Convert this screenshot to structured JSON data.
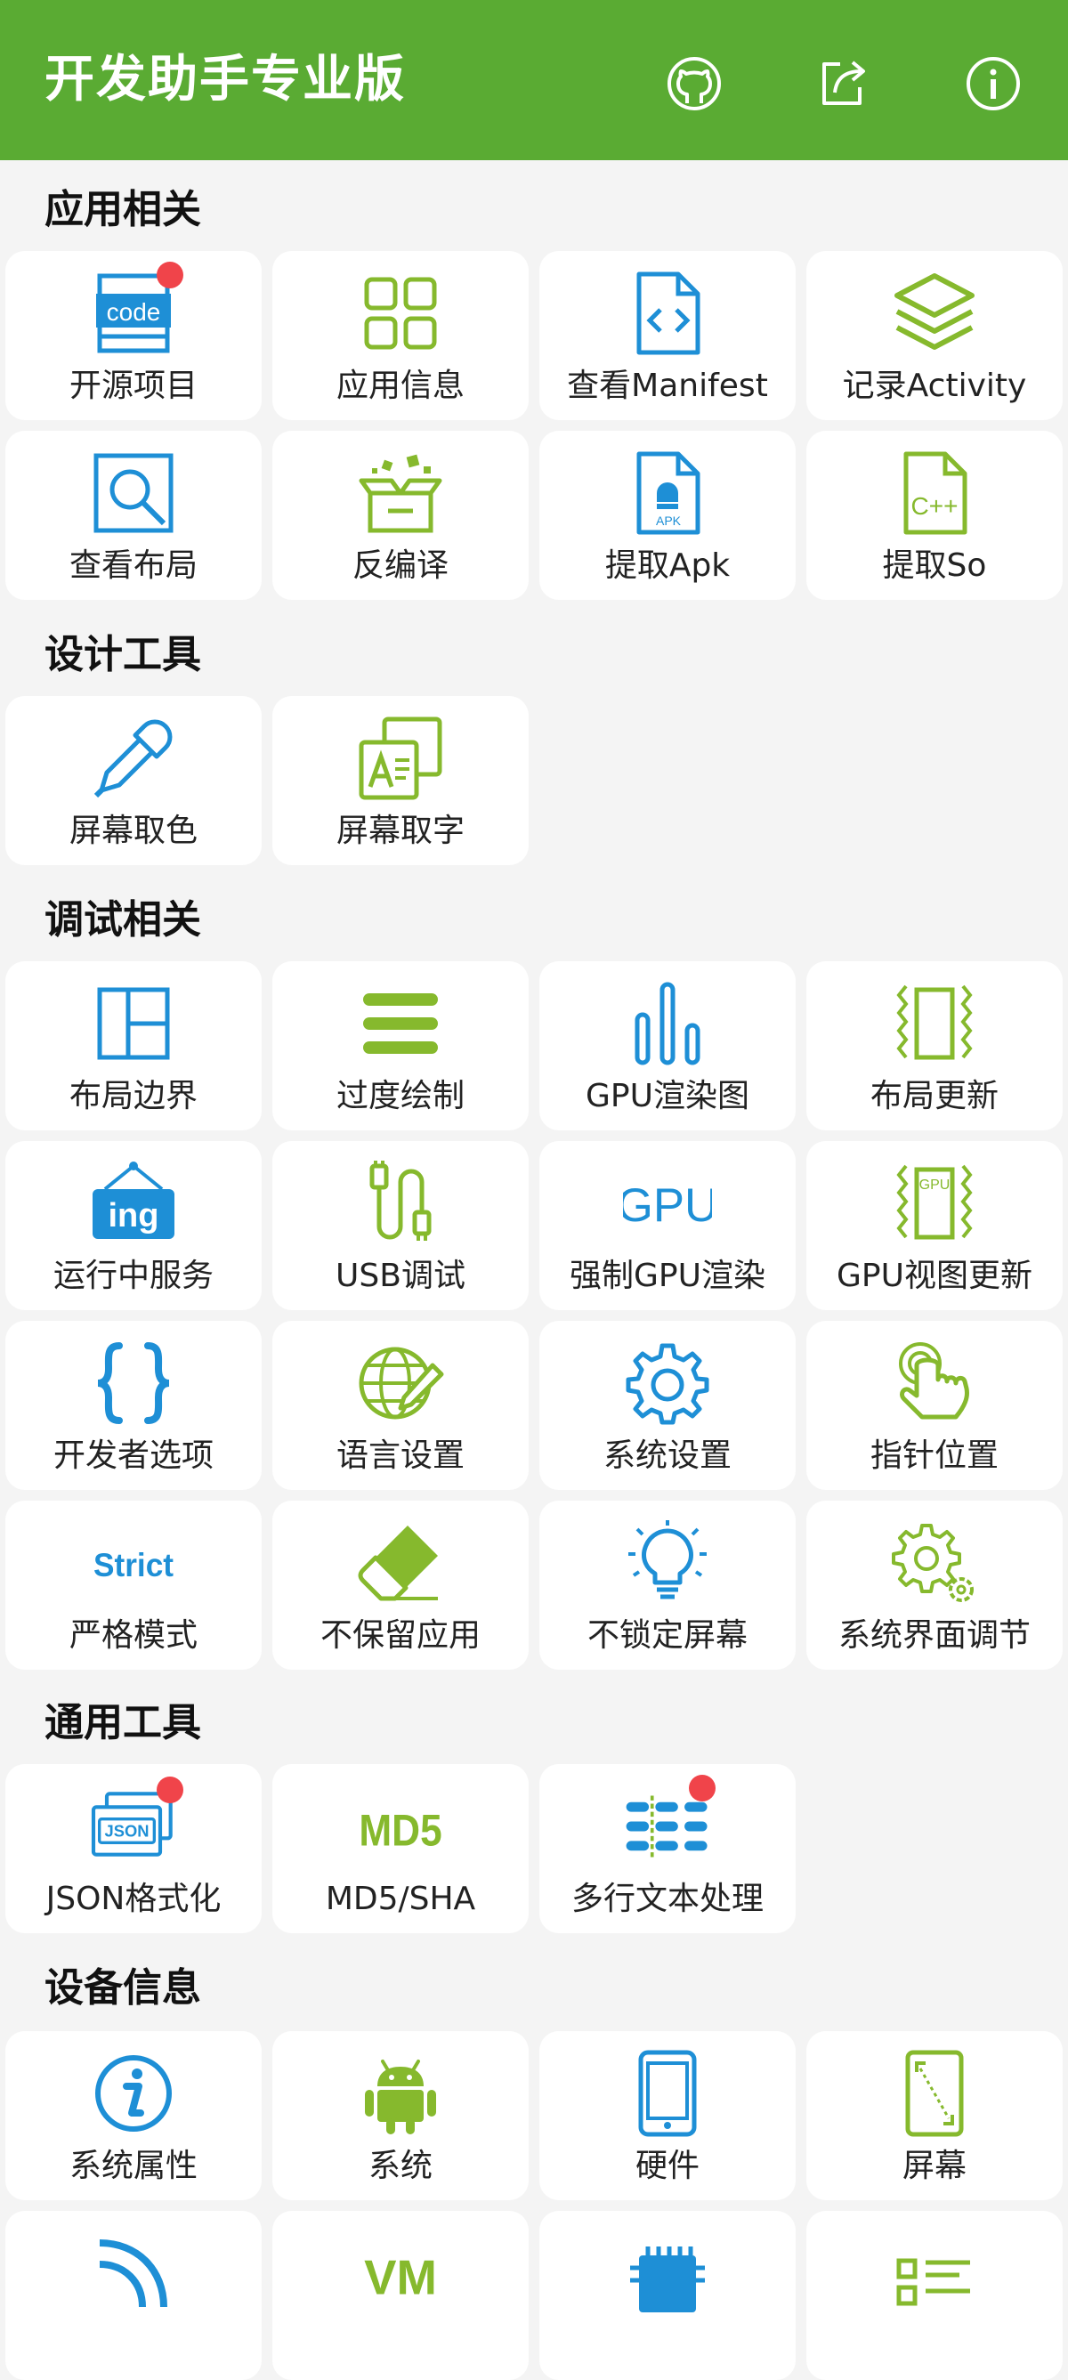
{
  "app": {
    "title": "开发助手专业版",
    "actions": [
      {
        "name": "github",
        "icon": "github-icon"
      },
      {
        "name": "share",
        "icon": "share-icon"
      },
      {
        "name": "about",
        "icon": "info-icon"
      }
    ],
    "colors": {
      "primary": "#5aab33",
      "icon_blue": "#1e8fd6",
      "icon_green": "#86b92d",
      "badge": "#f0444a"
    }
  },
  "sections": {
    "app_related": {
      "title": "应用相关",
      "items": [
        "开源项目",
        "应用信息",
        "查看Manifest",
        "记录Activity",
        "查看布局",
        "反编译",
        "提取Apk",
        "提取So"
      ]
    },
    "design_tools": {
      "title": "设计工具",
      "items": [
        "屏幕取色",
        "屏幕取字"
      ]
    },
    "debug_related": {
      "title": "调试相关",
      "items": [
        "布局边界",
        "过度绘制",
        "GPU渲染图",
        "布局更新",
        "运行中服务",
        "USB调试",
        "强制GPU渲染",
        "GPU视图更新",
        "开发者选项",
        "语言设置",
        "系统设置",
        "指针位置",
        "严格模式",
        "不保留应用",
        "不锁定屏幕",
        "系统界面调节"
      ]
    },
    "general_tools": {
      "title": "通用工具",
      "items": [
        "JSON格式化",
        "MD5/SHA",
        "多行文本处理"
      ]
    },
    "device_info": {
      "title": "设备信息",
      "items": [
        "系统属性",
        "系统",
        "硬件",
        "屏幕"
      ]
    }
  },
  "icon_text": {
    "code": "code",
    "apk": "APK",
    "cpp": "C++",
    "ing": "ing",
    "gpu": "GPU",
    "gpu_vertical": "GPU",
    "strict": "Strict",
    "json": "JSON",
    "md5": "MD5",
    "vm": "VM"
  },
  "badges": [
    "开源项目",
    "JSON格式化",
    "多行文本处理"
  ]
}
